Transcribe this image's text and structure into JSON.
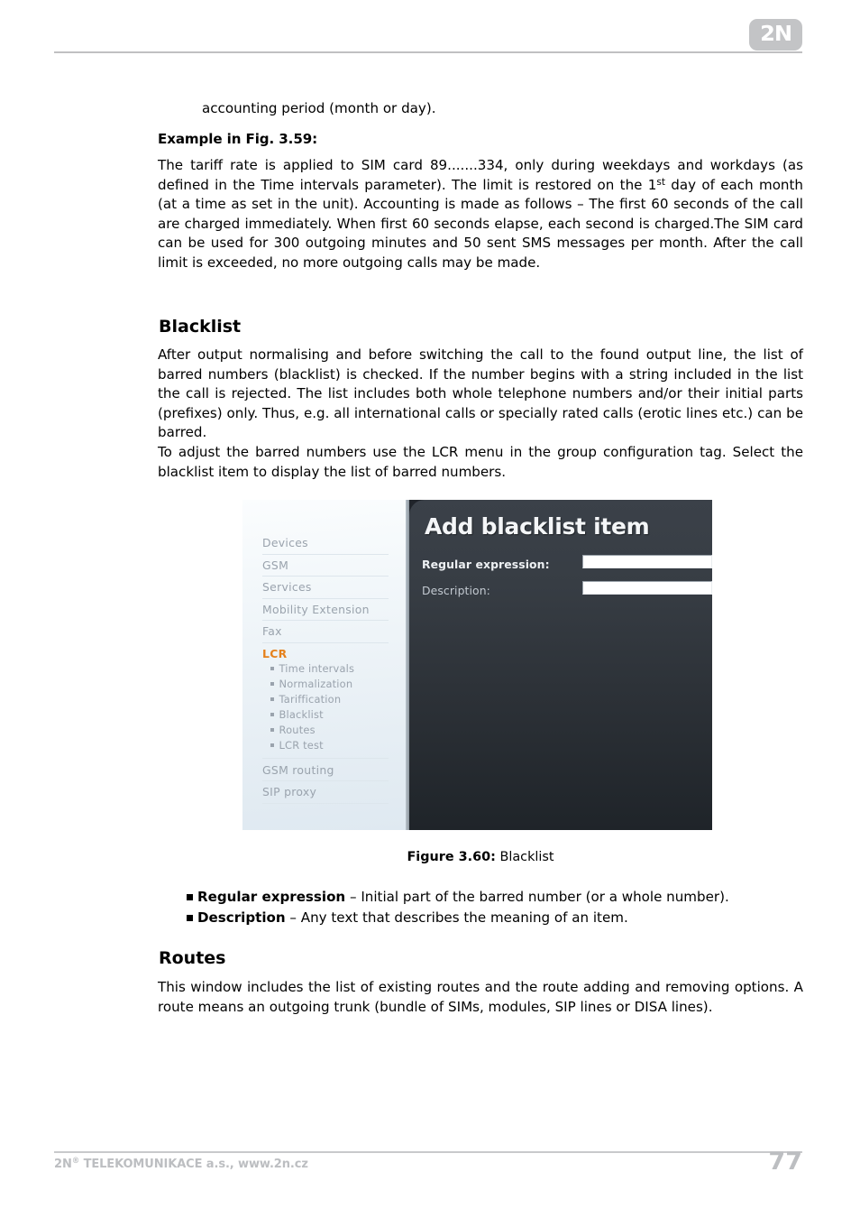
{
  "header": {
    "logo_text": "2N"
  },
  "body": {
    "continued_line": "accounting period (month or day).",
    "example_heading": "Example in Fig. 3.59:",
    "example_p1_a": "The tariff rate is applied to SIM card 89.......334, only during weekdays and workdays (as defined in the Time intervals parameter). The limit is restored on the 1",
    "example_p1_ord": "st",
    "example_p1_b": " day of each month (at a time as set in the unit). Accounting is made as follows – The first 60 seconds of the call are charged immediately. When first 60 seconds elapse, each second is charged.The SIM card can be used for 300 outgoing minutes and 50 sent SMS messages per month. After the call limit is exceeded, no more outgoing calls may be made.",
    "blacklist_heading": "Blacklist",
    "blacklist_p1": "After output normalising and before switching the call to the found output line, the list of barred numbers (blacklist) is checked. If the number begins with a string included in the list the call is rejected. The list includes both whole telephone numbers and/or their initial parts (prefixes) only. Thus, e.g. all international calls or specially rated calls (erotic lines etc.) can be barred.",
    "blacklist_p2": "To adjust the barred numbers use the LCR menu in the group configuration tag. Select the blacklist item to display the list of barred numbers.",
    "routes_heading": "Routes",
    "routes_p1": "This window includes the list of existing routes and the route adding and removing options. A route means an outgoing trunk (bundle of SIMs, modules, SIP lines or DISA lines)."
  },
  "figure": {
    "caption_label": "Figure 3.60:",
    "caption_text": " Blacklist",
    "screenshot": {
      "sidebar": {
        "items": [
          {
            "label": "Devices",
            "type": "top",
            "active": false
          },
          {
            "label": "GSM",
            "type": "top",
            "active": false
          },
          {
            "label": "Services",
            "type": "top",
            "active": false
          },
          {
            "label": "Mobility Extension",
            "type": "top",
            "active": false
          },
          {
            "label": "Fax",
            "type": "top",
            "active": false
          },
          {
            "label": "LCR",
            "type": "top",
            "active": true
          },
          {
            "label": "Time intervals",
            "type": "sub",
            "active": false
          },
          {
            "label": "Normalization",
            "type": "sub",
            "active": false
          },
          {
            "label": "Tariffication",
            "type": "sub",
            "active": false
          },
          {
            "label": "Blacklist",
            "type": "sub",
            "active": false
          },
          {
            "label": "Routes",
            "type": "sub",
            "active": false
          },
          {
            "label": "LCR test",
            "type": "sub",
            "active": false
          },
          {
            "label": "GSM routing",
            "type": "top",
            "active": false
          },
          {
            "label": "SIP proxy",
            "type": "top",
            "active": false
          }
        ],
        "active_color": "#e5811c",
        "item_color": "#9aa3ad"
      },
      "panel": {
        "title": "Add blacklist item",
        "background_color": "#373d44",
        "fields": [
          {
            "label": "Regular expression:",
            "value": "",
            "emphasis": "strong"
          },
          {
            "label": "Description:",
            "value": "",
            "emphasis": "soft"
          }
        ]
      }
    }
  },
  "bullets": [
    {
      "term": "Regular expression",
      "desc": " – Initial part of the barred number (or a whole number)."
    },
    {
      "term": "Description",
      "desc": " – Any text that describes the meaning of an item."
    }
  ],
  "footer": {
    "company_prefix": "2N",
    "registered_mark": "®",
    "company_rest": " TELEKOMUNIKACE a.s., www.2n.cz",
    "page_number": "77"
  }
}
